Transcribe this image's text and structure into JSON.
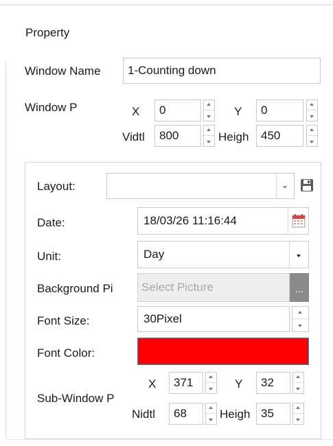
{
  "property_title": "Property",
  "window_name": {
    "label": "Window Name",
    "value": "1-Counting down"
  },
  "window_pos": {
    "label": "Window P",
    "x_label": "X",
    "x_value": "0",
    "y_label": "Y",
    "y_value": "0",
    "width_label": "Vidtl",
    "width_value": "800",
    "height_label": "Heigh",
    "height_value": "450"
  },
  "layout": {
    "label": "Layout:",
    "value": "",
    "save_icon": "save-icon"
  },
  "date": {
    "label": "Date:",
    "value": "18/03/26 11:16:44",
    "icon": "calendar-icon"
  },
  "unit": {
    "label": "Unit:",
    "value": "Day"
  },
  "background_picture": {
    "label": "Background Pi",
    "placeholder": "Select Picture",
    "browse_label": "..."
  },
  "font_size": {
    "label": "Font Size:",
    "value": "30Pixel"
  },
  "font_color": {
    "label": "Font Color:",
    "color": "#ff0000"
  },
  "sub_window_pos": {
    "label": "Sub-Window P",
    "x_label": "X",
    "x_value": "371",
    "y_label": "Y",
    "y_value": "32",
    "width_label": "Nidtl",
    "width_value": "68",
    "height_label": "Heigh",
    "height_value": "35"
  },
  "colors": {
    "accent_border": "#00a3d9",
    "font_color_swatch": "#ff0000"
  }
}
